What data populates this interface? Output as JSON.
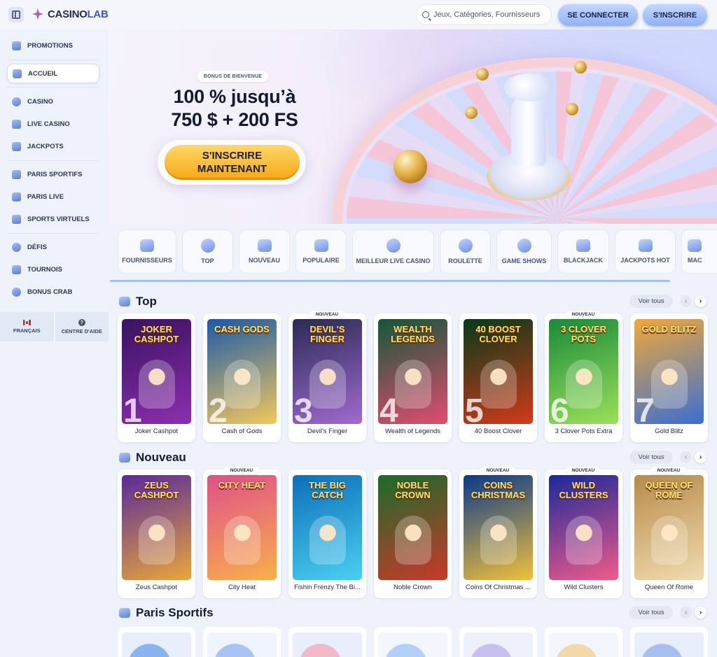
{
  "header": {
    "logo_primary": "CASINO",
    "logo_accent": "LAB",
    "search_placeholder": "Jeux, Catégories, Fournisseurs",
    "login": "SE CONNECTER",
    "signup": "S'INSCRIRE"
  },
  "sidebar": {
    "items": [
      {
        "label": "PROMOTIONS",
        "icon": "megaphone-icon"
      },
      {
        "label": "ACCUEIL",
        "icon": "home-icon"
      },
      {
        "label": "CASINO",
        "icon": "chip-icon"
      },
      {
        "label": "LIVE CASINO",
        "icon": "live-icon"
      },
      {
        "label": "JACKPOTS",
        "icon": "jackpot-icon"
      },
      {
        "label": "PARIS SPORTIFS",
        "icon": "ticket-icon"
      },
      {
        "label": "PARIS LIVE",
        "icon": "live-bet-icon"
      },
      {
        "label": "SPORTS VIRTUELS",
        "icon": "play-icon"
      },
      {
        "label": "DÉFIS",
        "icon": "target-icon"
      },
      {
        "label": "TOURNOIS",
        "icon": "trophy-icon"
      },
      {
        "label": "BONUS CRAB",
        "icon": "crab-icon"
      }
    ],
    "language": "FRANÇAIS",
    "help": "CENTRE D'AIDE"
  },
  "hero": {
    "badge": "BONUS DE BIENVENUE",
    "line1": "100 % jusqu’à",
    "line2": "750 $ + 200 FS",
    "cta_line1": "S'INSCRIRE",
    "cta_line2": "MAINTENANT"
  },
  "categories": [
    "FOURNISSEURS",
    "TOP",
    "NOUVEAU",
    "POPULAIRE",
    "MEILLEUR LIVE CASINO",
    "ROULETTE",
    "GAME SHOWS",
    "BLACKJACK",
    "JACKPOTS HOT",
    "MAC"
  ],
  "sections": {
    "top": {
      "title": "Top",
      "see_all": "Voir tous",
      "games": [
        {
          "name": "Joker Cashpot",
          "art": "JOKER CASHPOT",
          "rank": "1",
          "new": "",
          "colors": [
            "#3a1260",
            "#8c2fb0"
          ]
        },
        {
          "name": "Cash of Gods",
          "art": "CASH GODS",
          "rank": "2",
          "new": "",
          "colors": [
            "#1b5aa8",
            "#f2c75c"
          ]
        },
        {
          "name": "Devil's Finger",
          "art": "DEVIL'S FINGER",
          "rank": "3",
          "new": "NOUVEAU",
          "colors": [
            "#2a2a55",
            "#a06bd0"
          ]
        },
        {
          "name": "Wealth of Legends",
          "art": "WEALTH LEGENDS",
          "rank": "4",
          "new": "",
          "colors": [
            "#15573a",
            "#e04d6f"
          ]
        },
        {
          "name": "40 Boost Clover",
          "art": "40 BOOST CLOVER",
          "rank": "5",
          "new": "",
          "colors": [
            "#063a1a",
            "#d23a1a"
          ]
        },
        {
          "name": "3 Clover Pots Extra",
          "art": "3 CLOVER POTS",
          "rank": "6",
          "new": "NOUVEAU",
          "colors": [
            "#1a8a3a",
            "#9be05a"
          ]
        },
        {
          "name": "Gold Blitz",
          "art": "GOLD BLITZ",
          "rank": "7",
          "new": "",
          "colors": [
            "#f0a83a",
            "#3b6fd0"
          ]
        }
      ]
    },
    "new": {
      "title": "Nouveau",
      "see_all": "Voir tous",
      "games": [
        {
          "name": "Zeus Cashpot",
          "art": "ZEUS CASHPOT",
          "new": "",
          "colors": [
            "#5a2a9a",
            "#e8a63a"
          ]
        },
        {
          "name": "City Heat",
          "art": "CITY HEAT",
          "new": "NOUVEAU",
          "colors": [
            "#e0508a",
            "#f7b04a"
          ]
        },
        {
          "name": "Fishin Frenzy The Bi...",
          "art": "THE BIG CATCH",
          "new": "",
          "colors": [
            "#0c6fb8",
            "#4ad0f0"
          ]
        },
        {
          "name": "Noble Crown",
          "art": "NOBLE CROWN",
          "new": "",
          "colors": [
            "#1b6b2a",
            "#c83a2a"
          ]
        },
        {
          "name": "Coins Of Christmas ...",
          "art": "COINS CHRISTMAS",
          "new": "NOUVEAU",
          "colors": [
            "#0b3a8a",
            "#f0c03a"
          ]
        },
        {
          "name": "Wild Clusters",
          "art": "WILD CLUSTERS",
          "new": "NOUVEAU",
          "colors": [
            "#1a2a9a",
            "#f05a8a"
          ]
        },
        {
          "name": "Queen Of Rome",
          "art": "QUEEN OF ROME",
          "new": "NOUVEAU",
          "colors": [
            "#b88a4a",
            "#f0dcb0"
          ]
        }
      ]
    },
    "sports": {
      "title": "Paris Sportifs",
      "see_all": "Voir tous",
      "cards": [
        {
          "colors": [
            "#8ab4f0",
            "#e8eefb"
          ]
        },
        {
          "colors": [
            "#a8c4f4",
            "#f0f4fd"
          ]
        },
        {
          "colors": [
            "#f0b8c8",
            "#e8eefb"
          ]
        },
        {
          "colors": [
            "#b0d0f8",
            "#f2f6fd"
          ]
        },
        {
          "colors": [
            "#c8c0f0",
            "#eef0fb"
          ]
        },
        {
          "colors": [
            "#f4d8a8",
            "#f4f6fd"
          ]
        },
        {
          "colors": [
            "#a8c0f0",
            "#e8eefb"
          ]
        }
      ]
    }
  },
  "colors": {
    "accent": "#3957d6",
    "cta": "#f7a813",
    "button": "#8fb1f5"
  }
}
